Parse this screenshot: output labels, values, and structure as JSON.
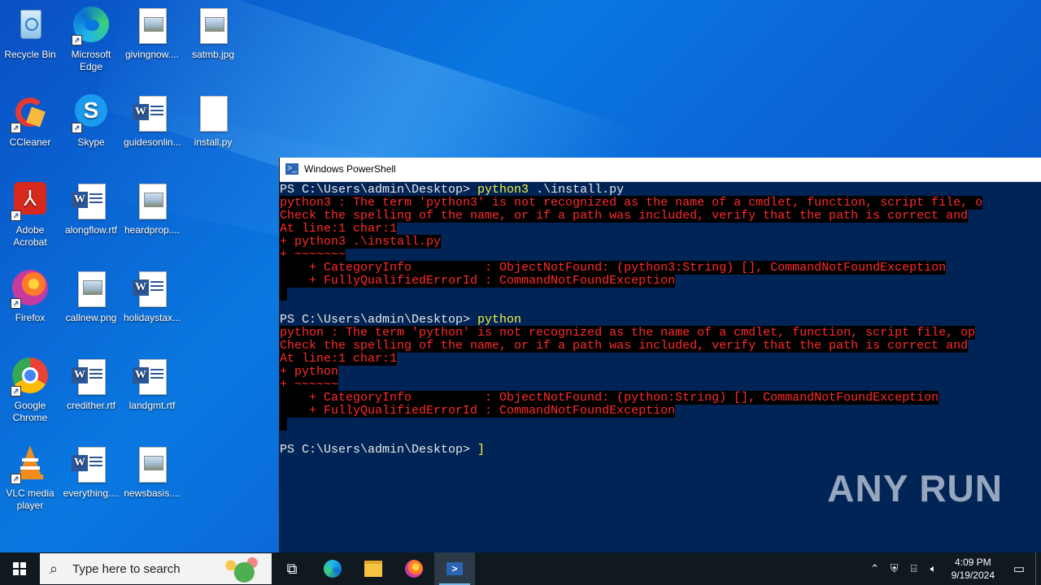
{
  "desktop_icons": [
    {
      "label": "Recycle Bin",
      "icon": "recycle-bin-icon"
    },
    {
      "label": "Microsoft Edge",
      "icon": "edge-icon"
    },
    {
      "label": "givingnow....",
      "icon": "image-file-icon"
    },
    {
      "label": "satmb.jpg",
      "icon": "image-file-icon"
    },
    {
      "label": "CCleaner",
      "icon": "ccleaner-icon"
    },
    {
      "label": "Skype",
      "icon": "skype-icon"
    },
    {
      "label": "guidesonlin...",
      "icon": "word-doc-icon"
    },
    {
      "label": "install.py",
      "icon": "blank-file-icon"
    },
    {
      "label": "Adobe Acrobat",
      "icon": "acrobat-icon"
    },
    {
      "label": "alongflow.rtf",
      "icon": "word-doc-icon"
    },
    {
      "label": "heardprop....",
      "icon": "image-file-icon"
    },
    {
      "label": "Firefox",
      "icon": "firefox-icon"
    },
    {
      "label": "callnew.png",
      "icon": "image-file-icon"
    },
    {
      "label": "holidaystax...",
      "icon": "word-doc-icon"
    },
    {
      "label": "Google Chrome",
      "icon": "chrome-icon"
    },
    {
      "label": "credither.rtf",
      "icon": "word-doc-icon"
    },
    {
      "label": "landgmt.rtf",
      "icon": "word-doc-icon"
    },
    {
      "label": "VLC media player",
      "icon": "vlc-icon"
    },
    {
      "label": "everything....",
      "icon": "word-doc-icon"
    },
    {
      "label": "newsbasis....",
      "icon": "image-file-icon"
    }
  ],
  "powershell": {
    "title": "Windows PowerShell",
    "lines": [
      {
        "type": "cmd",
        "prompt": "PS C:\\Users\\admin\\Desktop> ",
        "command": "python3",
        "args": " .\\install.py"
      },
      {
        "type": "err",
        "text": "python3 : The term 'python3' is not recognized as the name of a cmdlet, function, script file, o"
      },
      {
        "type": "err",
        "text": "Check the spelling of the name, or if a path was included, verify that the path is correct and"
      },
      {
        "type": "err",
        "text": "At line:1 char:1"
      },
      {
        "type": "err",
        "text": "+ python3 .\\install.py"
      },
      {
        "type": "err",
        "text": "+ ~~~~~~~"
      },
      {
        "type": "err",
        "text": "    + CategoryInfo          : ObjectNotFound: (python3:String) [], CommandNotFoundException"
      },
      {
        "type": "err",
        "text": "    + FullyQualifiedErrorId : CommandNotFoundException"
      },
      {
        "type": "err",
        "text": " "
      },
      {
        "type": "blank",
        "text": ""
      },
      {
        "type": "cmd",
        "prompt": "PS C:\\Users\\admin\\Desktop> ",
        "command": "python",
        "args": ""
      },
      {
        "type": "err",
        "text": "python : The term 'python' is not recognized as the name of a cmdlet, function, script file, op"
      },
      {
        "type": "err",
        "text": "Check the spelling of the name, or if a path was included, verify that the path is correct and"
      },
      {
        "type": "err",
        "text": "At line:1 char:1"
      },
      {
        "type": "err",
        "text": "+ python"
      },
      {
        "type": "err",
        "text": "+ ~~~~~~"
      },
      {
        "type": "err",
        "text": "    + CategoryInfo          : ObjectNotFound: (python:String) [], CommandNotFoundException"
      },
      {
        "type": "err",
        "text": "    + FullyQualifiedErrorId : CommandNotFoundException"
      },
      {
        "type": "err",
        "text": " "
      },
      {
        "type": "blank",
        "text": ""
      },
      {
        "type": "cmd",
        "prompt": "PS C:\\Users\\admin\\Desktop> ",
        "command": "]",
        "args": ""
      }
    ]
  },
  "watermark": "ANY RUN",
  "taskbar": {
    "search_placeholder": "Type here to search",
    "time": "4:09 PM",
    "date": "9/19/2024"
  },
  "colors": {
    "console_bg": "#012456",
    "error_text": "#ff2a2a",
    "command_text": "#f5f13b",
    "taskbar_bg": "#101820"
  }
}
